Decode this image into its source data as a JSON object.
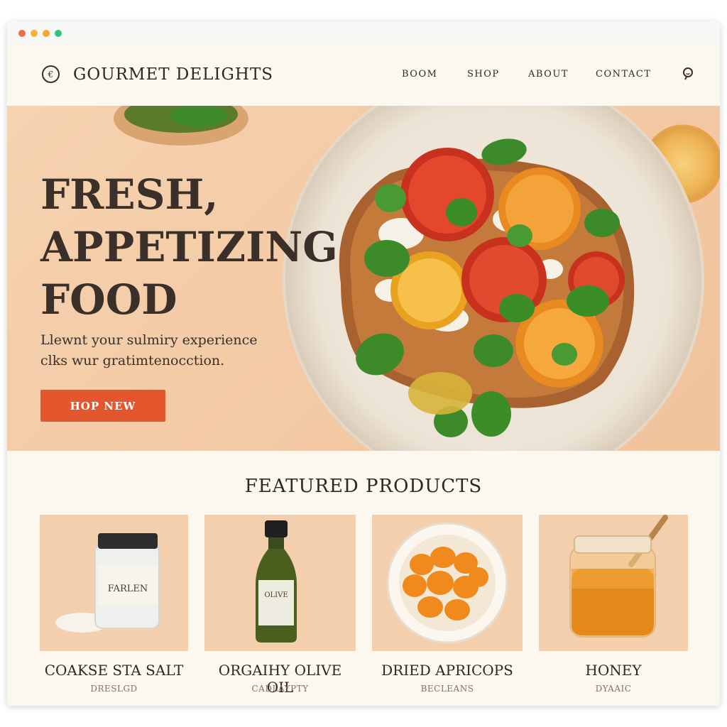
{
  "header": {
    "brand": "GOURMET DELIGHTS",
    "nav": [
      "BOOM",
      "SHOP",
      "ABOUT",
      "CONTACT"
    ]
  },
  "hero": {
    "title_lines": [
      "FRESH,",
      "APPETIZING",
      "FOOD"
    ],
    "subtitle_lines": [
      "Llewnt your sulmiry experience",
      "clks wur gratimtenocction."
    ],
    "cta_label": "HOP NEW"
  },
  "featured": {
    "title": "FEATURED PRODUCTS",
    "products": [
      {
        "name": "COAKSE STA SALT",
        "sub": "DRESLGD",
        "label": "FARLEN"
      },
      {
        "name": "ORGAIHY OLIVE OIL",
        "sub": "CADLAYPTY",
        "label": "OLIVE"
      },
      {
        "name": "DRIED APRICOPS",
        "sub": "BECLEANS",
        "label": ""
      },
      {
        "name": "HONEY",
        "sub": "DYAAIC",
        "label": ""
      }
    ]
  },
  "colors": {
    "accent": "#e4572e",
    "hero_bg": "#f3cba6",
    "page_bg": "#fdf8ef",
    "text": "#2f2722"
  }
}
